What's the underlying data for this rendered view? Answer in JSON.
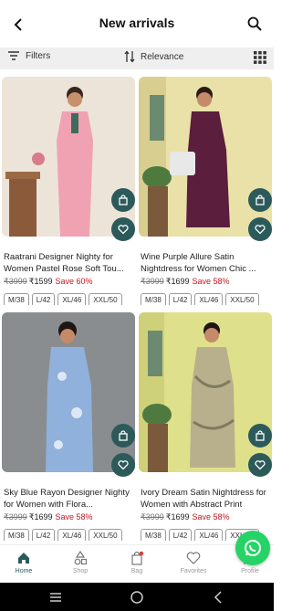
{
  "header": {
    "title": "New arrivals",
    "back_icon": "chevron-left-icon",
    "search_icon": "search-icon"
  },
  "toolbar": {
    "filters_label": "Filters",
    "sort_label": "Relevance"
  },
  "products": [
    {
      "name": "Raatrani Designer Nighty for Women Pastel Rose Soft Tou...",
      "mrp": "₹3999",
      "price": "₹1599",
      "discount": "Save 60%",
      "sizes": [
        "M/38",
        "L/42",
        "XL/46",
        "XXL/50"
      ],
      "dress_color": "#f0a2b2",
      "bg_color": "#ede4d9"
    },
    {
      "name": "Wine Purple Allure Satin Nightdress for Women Chic ...",
      "mrp": "₹3999",
      "price": "₹1699",
      "discount": "Save 58%",
      "sizes": [
        "M/38",
        "L/42",
        "XL/46",
        "XXL/50"
      ],
      "dress_color": "#5b1e3d",
      "bg_color": "#e9e1a8"
    },
    {
      "name": "Sky Blue Rayon Designer Nighty for Women with Flora...",
      "mrp": "₹3999",
      "price": "₹1699",
      "discount": "Save 58%",
      "sizes": [
        "M/38",
        "L/42",
        "XL/46",
        "XXL/50"
      ],
      "dress_color": "#8fb1db",
      "bg_color": "#8a8d90"
    },
    {
      "name": "Ivory Dream Satin Nightdress for Women with Abstract Print",
      "mrp": "₹3999",
      "price": "₹1699",
      "discount": "Save 58%",
      "sizes": [
        "M/38",
        "L/42",
        "XL/46",
        "XXL/50"
      ],
      "dress_color": "#b8b08d",
      "bg_color": "#dfe08b"
    }
  ],
  "bottom_nav": [
    {
      "label": "Home",
      "icon": "home-icon",
      "active": true
    },
    {
      "label": "Shop",
      "icon": "shapes-icon",
      "active": false
    },
    {
      "label": "Bag",
      "icon": "bag-icon",
      "active": false
    },
    {
      "label": "Favorites",
      "icon": "heart-icon",
      "active": false
    },
    {
      "label": "Profile",
      "icon": "profile-icon",
      "active": false
    }
  ],
  "colors": {
    "accent": "#2c5a5b",
    "discount": "#c2161f",
    "whatsapp": "#25d366"
  }
}
